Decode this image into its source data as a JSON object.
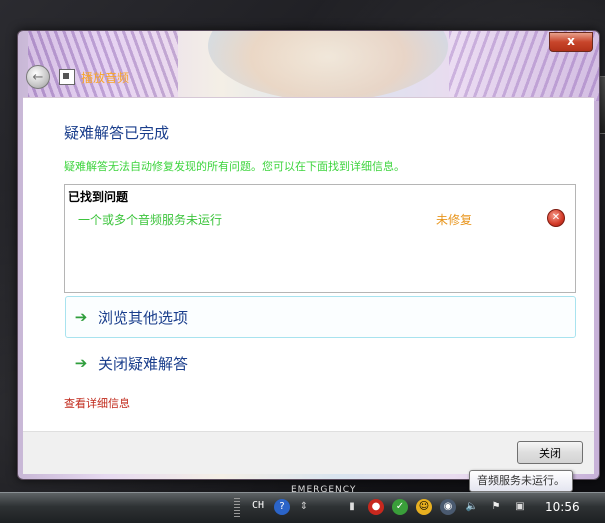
{
  "window": {
    "title": "播放音频",
    "close_glyph": "x",
    "back_glyph": "←"
  },
  "content": {
    "heading": "疑难解答已完成",
    "description": "疑难解答无法自动修复发现的所有问题。您可以在下面找到详细信息。",
    "issues_header": "已找到问题",
    "issues": [
      {
        "name": "一个或多个音频服务未运行",
        "status": "未修复",
        "icon": "error-icon"
      }
    ],
    "options": [
      {
        "label": "浏览其他选项",
        "icon": "green-arrow-icon"
      },
      {
        "label": "关闭疑难解答",
        "icon": "green-arrow-icon"
      }
    ],
    "details_link": "查看详细信息"
  },
  "footer": {
    "close_label": "关闭"
  },
  "tooltip": "音频服务未运行。",
  "taskbar": {
    "label": "EMERGENCY",
    "language": "CH",
    "clock": "10:56"
  },
  "colors": {
    "heading": "#1a3e8c",
    "success_text": "#3cd43c",
    "warning_text": "#e8951c",
    "link_red": "#c0281a",
    "title_orange": "#f7a52a"
  }
}
